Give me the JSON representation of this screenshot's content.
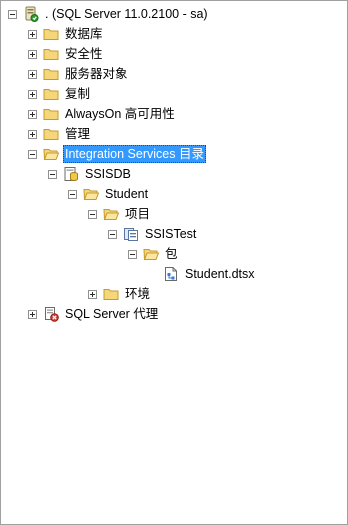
{
  "tree": {
    "server": {
      "label": ". (SQL Server 11.0.2100 - sa)",
      "icon": "server-icon",
      "expanded": true
    },
    "nodes": [
      {
        "label": "数据库",
        "icon": "folder-icon",
        "expanded": false
      },
      {
        "label": "安全性",
        "icon": "folder-icon",
        "expanded": false
      },
      {
        "label": "服务器对象",
        "icon": "folder-icon",
        "expanded": false
      },
      {
        "label": "复制",
        "icon": "folder-icon",
        "expanded": false
      },
      {
        "label": "AlwaysOn 高可用性",
        "icon": "folder-icon",
        "expanded": false
      },
      {
        "label": "管理",
        "icon": "folder-icon",
        "expanded": false
      },
      {
        "label": "Integration Services 目录",
        "icon": "folder-open-icon",
        "expanded": true,
        "selected": true
      }
    ],
    "catalog": {
      "ssisdb": {
        "label": "SSISDB",
        "icon": "database-icon",
        "expanded": true
      },
      "folder": {
        "label": "Student",
        "icon": "folder-open-icon",
        "expanded": true
      },
      "projects": {
        "label": "项目",
        "icon": "folder-open-icon",
        "expanded": true
      },
      "project": {
        "label": "SSISTest",
        "icon": "project-icon",
        "expanded": true
      },
      "packages": {
        "label": "包",
        "icon": "folder-open-icon",
        "expanded": true
      },
      "package": {
        "label": "Student.dtsx",
        "icon": "package-icon"
      },
      "environments": {
        "label": "环境",
        "icon": "folder-icon",
        "expanded": false
      }
    },
    "agent": {
      "label": "SQL Server 代理",
      "icon": "agent-icon",
      "expanded": false
    }
  },
  "colors": {
    "selection": "#3399ff",
    "folder_fill": "#f5d77a",
    "folder_edge": "#c79a2b"
  }
}
